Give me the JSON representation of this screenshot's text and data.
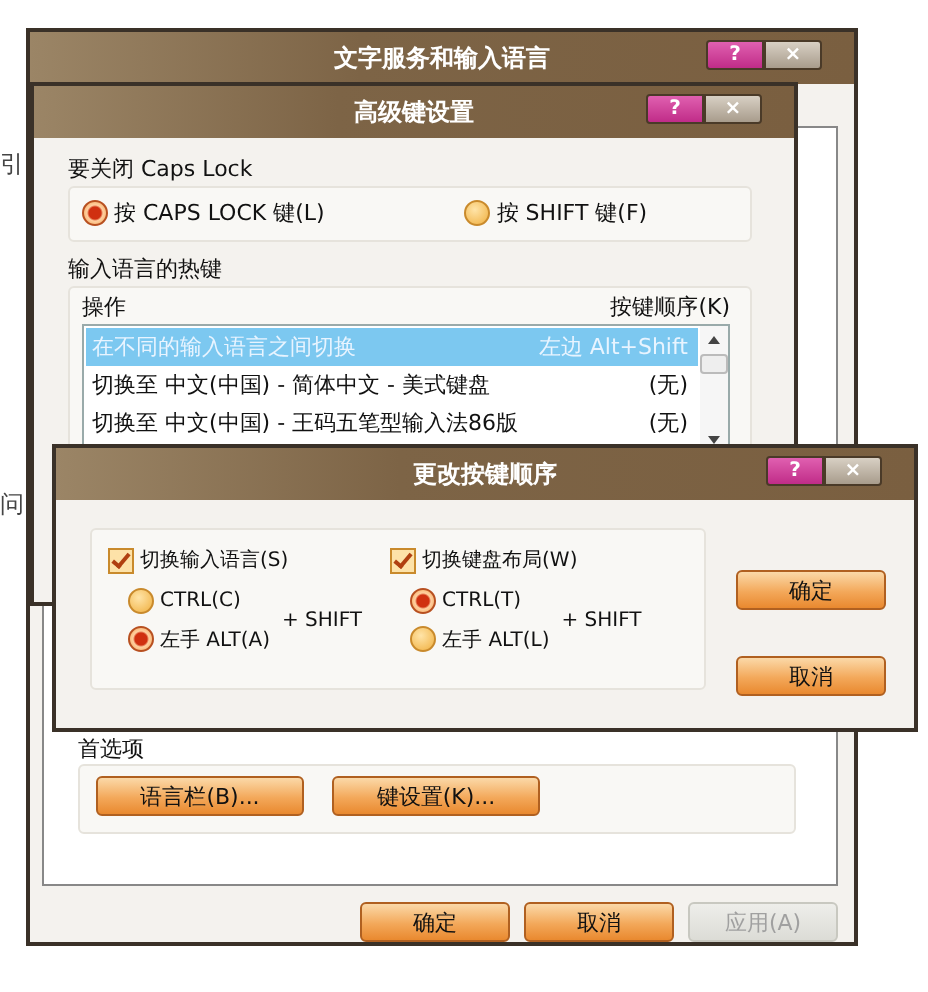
{
  "background_texts": [
    "引",
    "问"
  ],
  "main_window": {
    "title": "文字服务和输入语言",
    "title_buttons": [
      "?",
      "×"
    ],
    "group_title": "首选项",
    "group_buttons": [
      {
        "label": "语言栏(B)..."
      },
      {
        "label": "键设置(K)..."
      }
    ],
    "footer_buttons": [
      {
        "label": "确定",
        "disabled": false
      },
      {
        "label": "取消",
        "disabled": false
      },
      {
        "label": "应用(A)",
        "disabled": true
      }
    ]
  },
  "advanced_dialog": {
    "title": "高级键设置",
    "title_buttons": [
      "?",
      "×"
    ],
    "caps_group": {
      "title": "要关闭 Caps Lock",
      "options": [
        {
          "label": "按 CAPS LOCK 键(L)",
          "selected": true
        },
        {
          "label": "按 SHIFT 键(F)",
          "selected": false
        }
      ]
    },
    "hotkey_group": {
      "title": "输入语言的热键",
      "columns": [
        "操作",
        "按键顺序(K)"
      ],
      "rows": [
        {
          "action": "在不同的输入语言之间切换",
          "keys": "左边 Alt+Shift",
          "selected": true
        },
        {
          "action": "切换至 中文(中国) - 简体中文 - 美式键盘",
          "keys": "(无)",
          "selected": false
        },
        {
          "action": "切换至 中文(中国) - 王码五笔型输入法86版",
          "keys": "(无)",
          "selected": false
        }
      ]
    }
  },
  "change_dialog": {
    "title": "更改按键顺序",
    "title_buttons": [
      "?",
      "×"
    ],
    "sections": [
      {
        "label": "切换输入语言(S)",
        "checked": true,
        "suffix": "+ SHIFT",
        "options": [
          {
            "label": "CTRL(C)",
            "selected": false
          },
          {
            "label": "左手 ALT(A)",
            "selected": true
          }
        ]
      },
      {
        "label": "切换键盘布局(W)",
        "checked": true,
        "suffix": "+ SHIFT",
        "options": [
          {
            "label": "CTRL(T)",
            "selected": true
          },
          {
            "label": "左手 ALT(L)",
            "selected": false
          }
        ]
      }
    ],
    "buttons": [
      {
        "label": "确定"
      },
      {
        "label": "取消"
      }
    ]
  }
}
